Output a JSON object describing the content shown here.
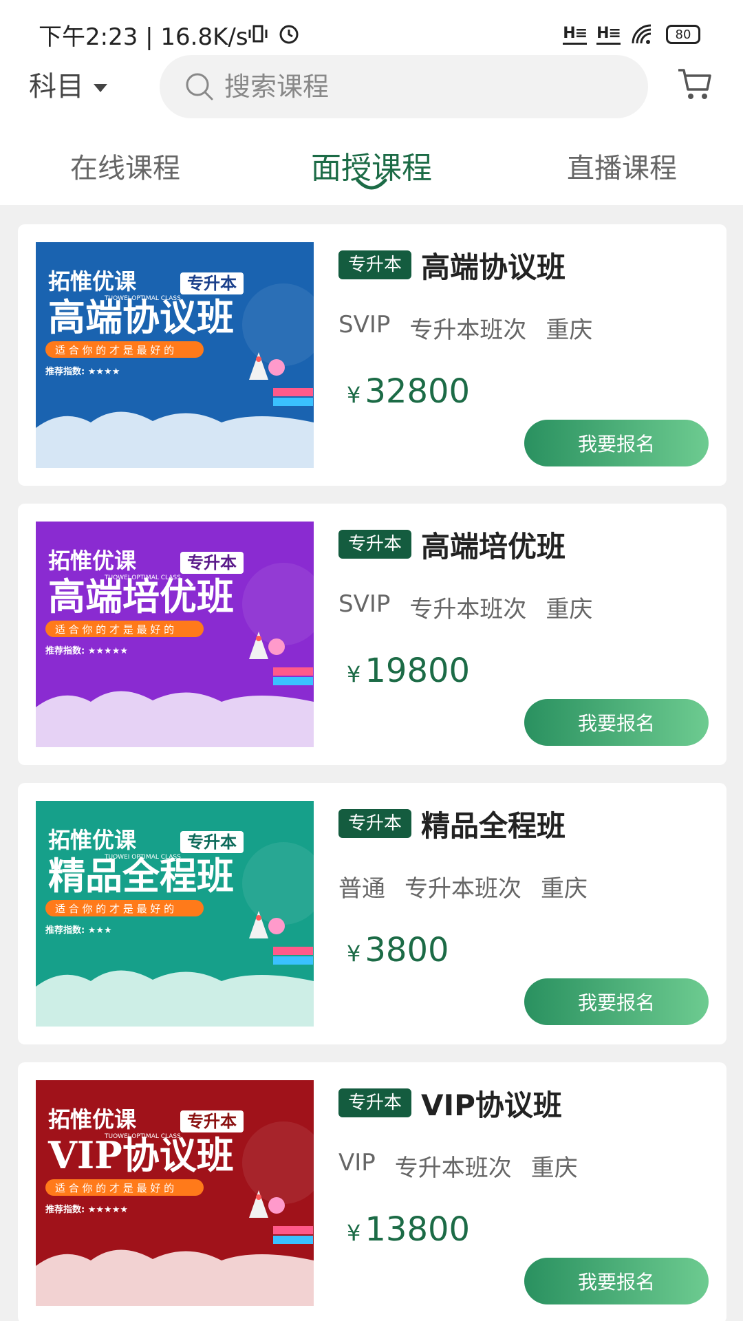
{
  "status_bar": {
    "text": "下午2:23 | 16.8K/s",
    "signal1": "H≡",
    "signal2": "H≡",
    "battery": "80"
  },
  "header": {
    "subject_label": "科目",
    "search_placeholder": "搜索课程"
  },
  "tabs": [
    {
      "label": "在线课程",
      "active": false
    },
    {
      "label": "面授课程",
      "active": true
    },
    {
      "label": "直播课程",
      "active": false
    }
  ],
  "courses": [
    {
      "tag": "专升本",
      "title": "高端协议班",
      "meta": [
        "SVIP",
        "专升本班次",
        "重庆"
      ],
      "price_symbol": "¥",
      "price": "32800",
      "button": "我要报名",
      "banner": {
        "brand": "拓惟优课",
        "brand_en": "TUOWEI OPTIMAL CLASS",
        "badge": "专升本",
        "headline": "高端协议班",
        "slogan": "适 合 你 的 才 是 最 好 的",
        "rating": "推荐指数: ★★★★",
        "bg": "#1a63b0",
        "cloud": "#d6e6f5"
      }
    },
    {
      "tag": "专升本",
      "title": "高端培优班",
      "meta": [
        "SVIP",
        "专升本班次",
        "重庆"
      ],
      "price_symbol": "¥",
      "price": "19800",
      "button": "我要报名",
      "banner": {
        "brand": "拓惟优课",
        "brand_en": "TUOWEI OPTIMAL CLASS",
        "badge": "专升本",
        "headline": "高端培优班",
        "slogan": "适 合 你 的 才 是 最 好 的",
        "rating": "推荐指数: ★★★★★",
        "bg": "#8a2bd1",
        "cloud": "#e6d2f5"
      }
    },
    {
      "tag": "专升本",
      "title": "精品全程班",
      "meta": [
        "普通",
        "专升本班次",
        "重庆"
      ],
      "price_symbol": "¥",
      "price": "3800",
      "button": "我要报名",
      "banner": {
        "brand": "拓惟优课",
        "brand_en": "TUOWEI OPTIMAL CLASS",
        "badge": "专升本",
        "headline": "精品全程班",
        "slogan": "适 合 你 的 才 是 最 好 的",
        "rating": "推荐指数: ★★★",
        "bg": "#16a08a",
        "cloud": "#cdeee6"
      }
    },
    {
      "tag": "专升本",
      "title": "VIP协议班",
      "meta": [
        "VIP",
        "专升本班次",
        "重庆"
      ],
      "price_symbol": "¥",
      "price": "13800",
      "button": "我要报名",
      "banner": {
        "brand": "拓惟优课",
        "brand_en": "TUOWEI OPTIMAL CLASS",
        "badge": "专升本",
        "headline": "VIP协议班",
        "slogan": "适 合 你 的 才 是 最 好 的",
        "rating": "推荐指数: ★★★★★",
        "bg": "#a0121a",
        "cloud": "#f2d2d2"
      }
    }
  ],
  "colors": {
    "accent": "#1c6b46",
    "tag_bg": "#145c3f",
    "button_from": "#2a9160",
    "button_to": "#6dcb90"
  },
  "icons": [
    "search-icon",
    "cart-icon",
    "caret-down-icon",
    "battery-icon",
    "signal-icon",
    "wifi-icon",
    "alarm-icon",
    "vibrate-icon"
  ]
}
